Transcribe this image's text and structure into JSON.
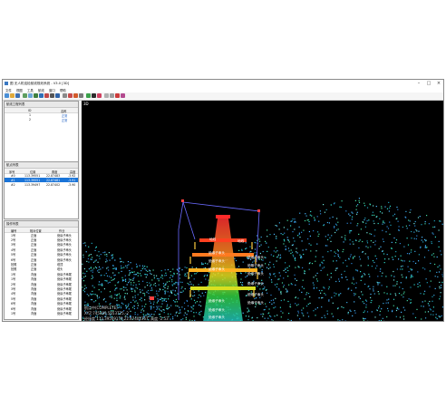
{
  "window": {
    "title": "图 无人机巡检航线规划系统 - V3.0 [3D]",
    "controls": [
      "–",
      "□",
      "×"
    ]
  },
  "menu": [
    "文件",
    "视图",
    "工具",
    "航线",
    "窗口",
    "帮助"
  ],
  "toolbar": {
    "icons": [
      "new-icon",
      "open-icon",
      "save-icon",
      "grid-icon",
      "zoom-in-icon",
      "zoom-out-icon",
      "measure-icon",
      "tower-icon",
      "pin-icon",
      "route-icon",
      "camera-icon",
      "point-icon",
      "play-icon",
      "link-icon",
      "export-icon",
      "settings-icon",
      "chart-icon",
      "layers-icon",
      "flag-icon",
      "upload-icon",
      "help-icon"
    ]
  },
  "panel_project": {
    "title": "航线工程列表",
    "headers": [
      "ID",
      "名称"
    ],
    "rows": [
      {
        "id": "1",
        "name": "正常"
      },
      {
        "id": "2",
        "name": "正常"
      }
    ]
  },
  "panel_points": {
    "title": "航点列表",
    "headers": [
      "序号",
      "位置",
      "角度",
      "高度"
    ],
    "rows": [
      {
        "no": "#0",
        "pos": "113.39551",
        "angle": "22.87483",
        "h": "-3.92"
      },
      {
        "no": "#1",
        "pos": "113.39551",
        "angle": "22.87481",
        "h": "-3.91"
      },
      {
        "no": "#2",
        "pos": "113.39497",
        "angle": "22.87402",
        "h": "-3.90"
      }
    ],
    "selected_index": 1
  },
  "panel_ops": {
    "title": "操作列表",
    "headers": [
      "编号",
      "相对位置",
      "作业"
    ],
    "rows": [
      {
        "c1": "1号",
        "c2": "正面",
        "c3": "绝缘子串头"
      },
      {
        "c1": "2号",
        "c2": "正面",
        "c3": "绝缘子串头"
      },
      {
        "c1": "3号",
        "c2": "正面",
        "c3": "绝缘子串头"
      },
      {
        "c1": "4号",
        "c2": "正面",
        "c3": "绝缘子串头"
      },
      {
        "c1": "5号",
        "c2": "正面",
        "c3": "绝缘子串头"
      },
      {
        "c1": "6号",
        "c2": "正面",
        "c3": "绝缘子串头"
      },
      {
        "c1": "拍照",
        "c2": "正面",
        "c3": "塔顶"
      },
      {
        "c1": "拍照",
        "c2": "正面",
        "c3": "塔头"
      },
      {
        "c1": "1号",
        "c2": "背面",
        "c3": "绝缘子串尾"
      },
      {
        "c1": "1号",
        "c2": "背面",
        "c3": "绝缘子串尾"
      },
      {
        "c1": "2号",
        "c2": "背面",
        "c3": "绝缘子串尾"
      },
      {
        "c1": "3号",
        "c2": "背面",
        "c3": "绝缘子串尾"
      },
      {
        "c1": "4号",
        "c2": "背面",
        "c3": "绝缘子串尾"
      },
      {
        "c1": "5号",
        "c2": "背面",
        "c3": "绝缘子串尾"
      },
      {
        "c1": "6号",
        "c2": "背面",
        "c3": "绝缘子串尾"
      },
      {
        "c1": "6号",
        "c2": "背面",
        "c3": "绝缘子串尾"
      },
      {
        "c1": "1号",
        "c2": "背面",
        "c3": "绝缘子串尾"
      }
    ]
  },
  "view": {
    "label": "3D",
    "labels_left": [
      "绝缘子串头",
      "绝缘子串头",
      "绝缘子串头",
      "绝缘子串头",
      "绝缘子串头",
      "绝缘子串头"
    ],
    "labels_right": [
      "绝缘子串头",
      "绝缘子串头",
      "绝缘子串头",
      "绝缘子串头",
      "绝缘子串头",
      "绝缘子串头"
    ],
    "top_left_label": "地线",
    "top_right_label": "地线",
    "status_mode": "航点中(COMPLETE)",
    "status_xyz": "XYZ:745409.5553725,-2",
    "status_pos": "经纬度 113.39549179,22.87402367, 高度 -2.53"
  },
  "colors": {
    "accent": "#1a74d8",
    "viewport_bg": "#000000"
  }
}
